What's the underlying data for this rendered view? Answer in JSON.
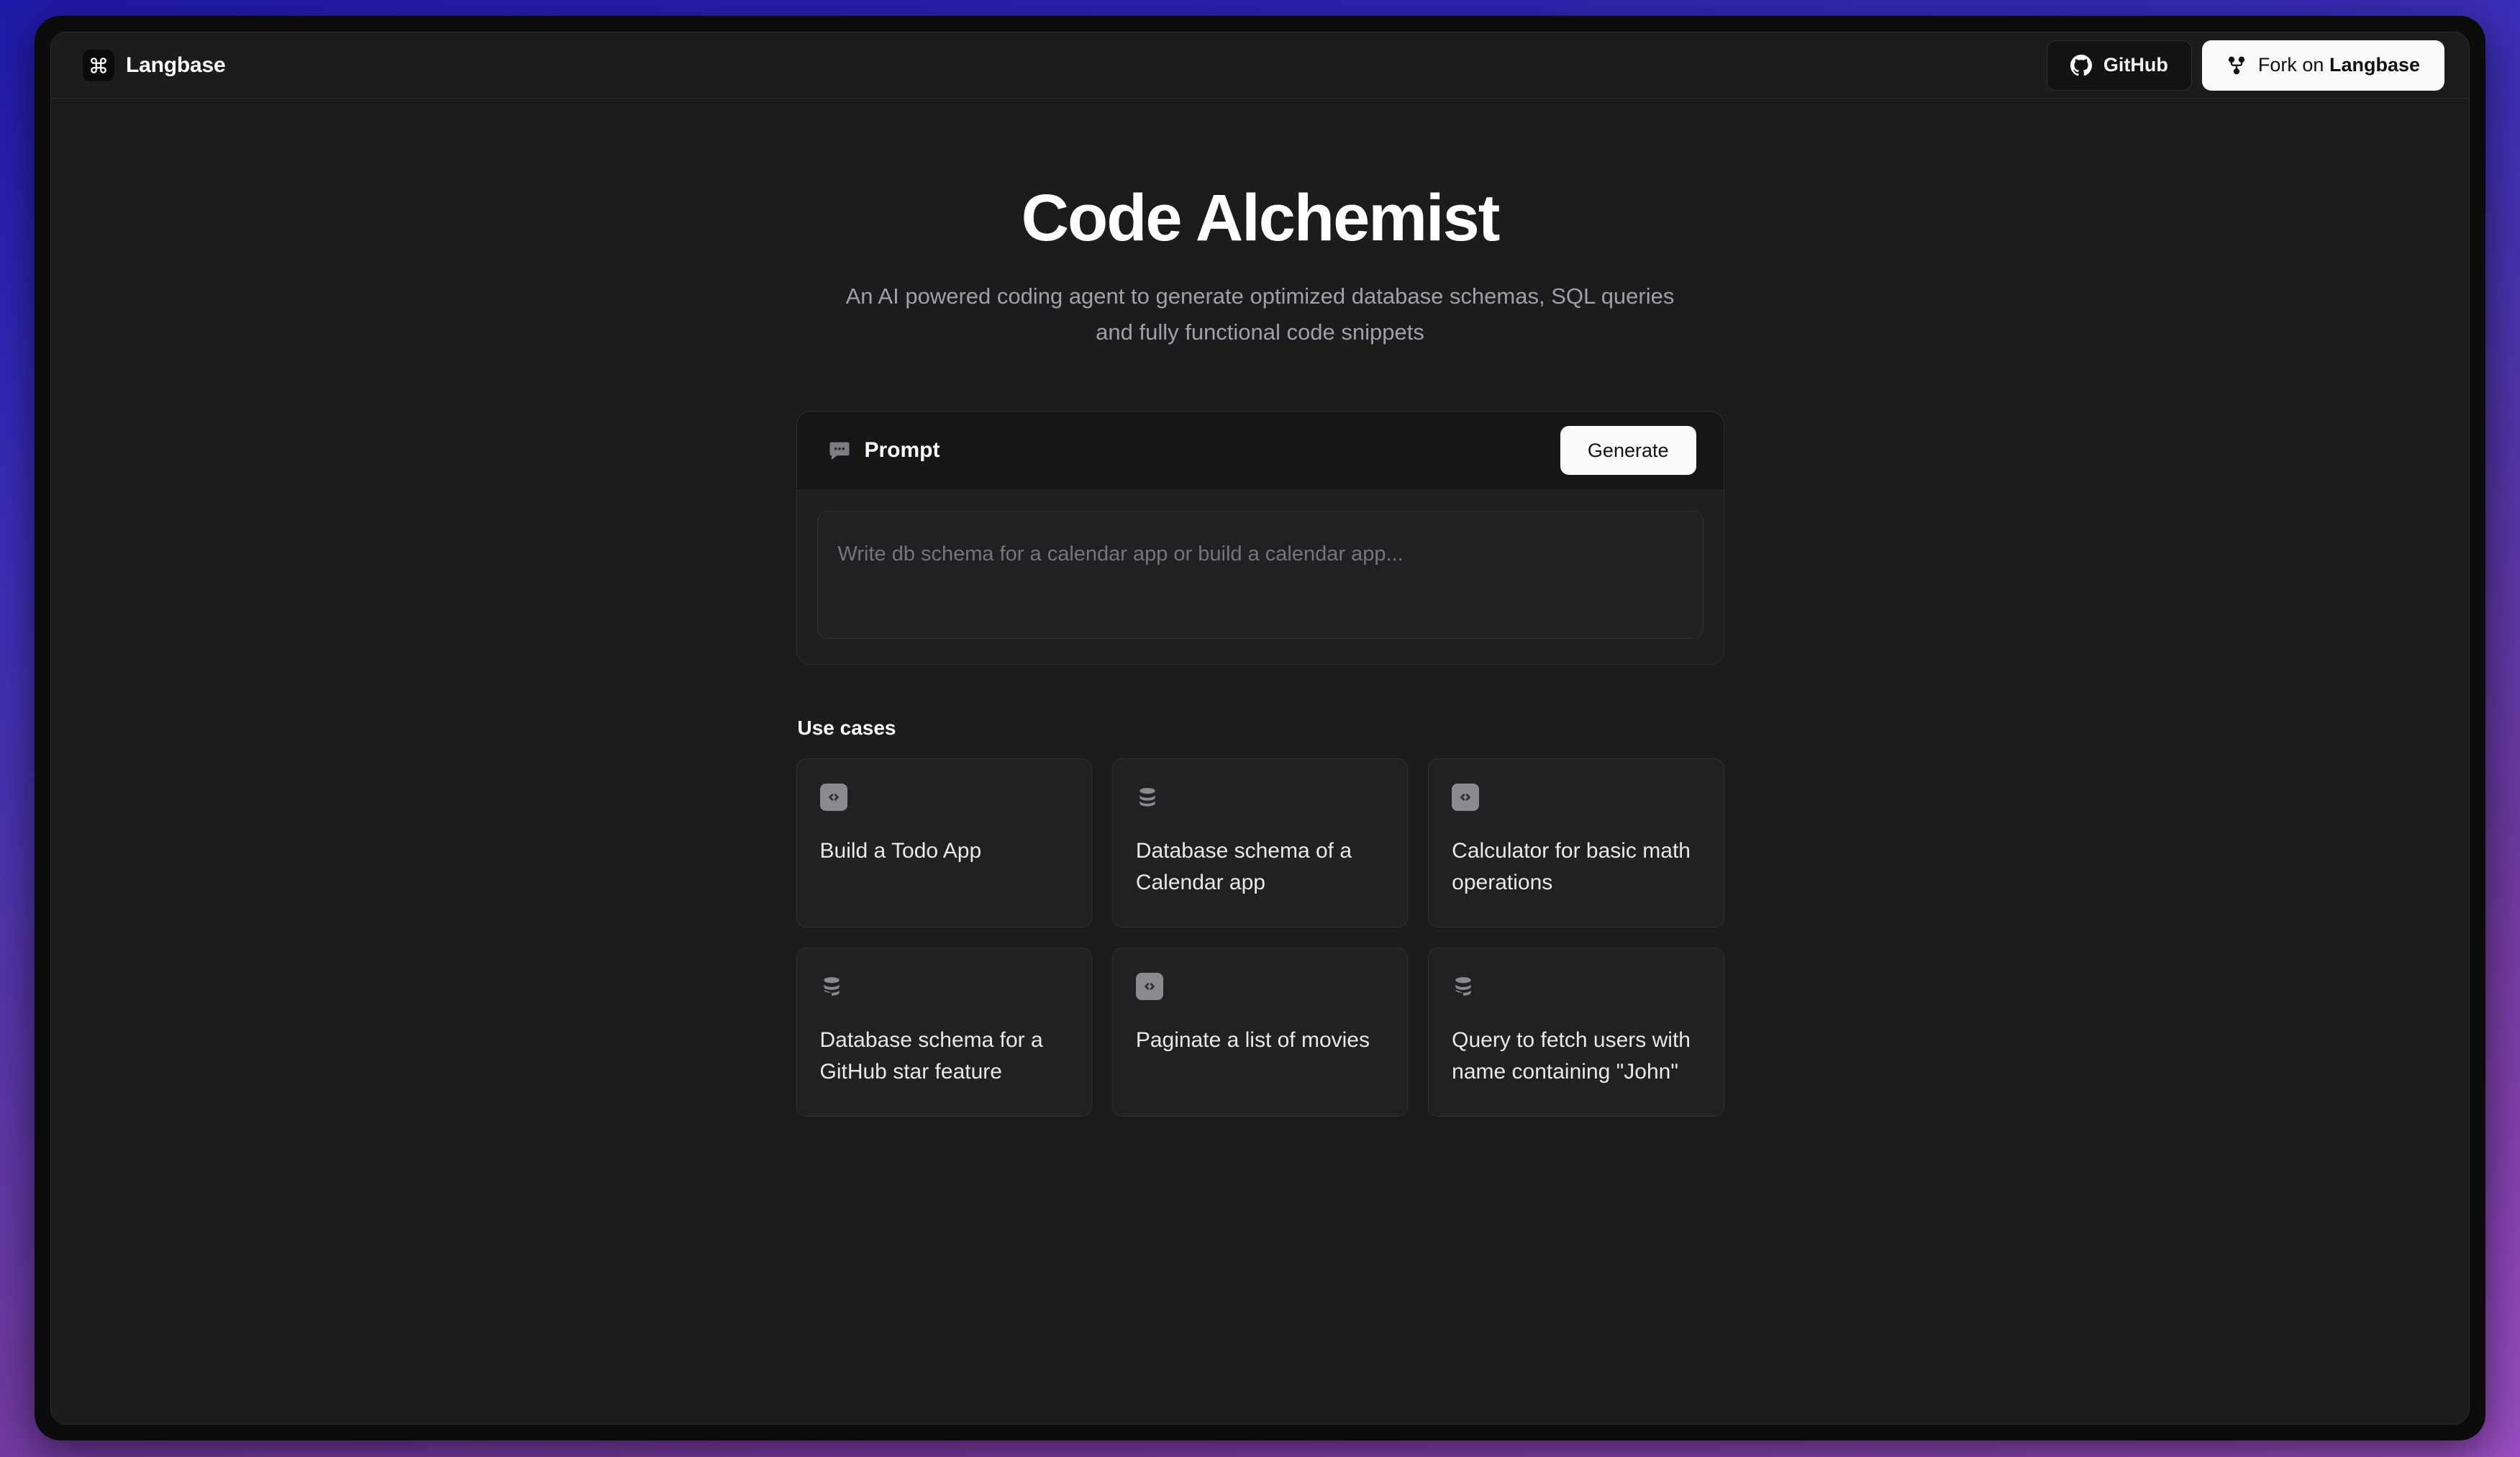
{
  "header": {
    "brand_name": "Langbase",
    "logo_icon": "command-icon",
    "github_button": {
      "label": "GitHub",
      "icon": "github-icon"
    },
    "fork_button": {
      "label_prefix": "Fork on ",
      "label_brand": "Langbase",
      "icon": "git-fork-icon"
    }
  },
  "hero": {
    "title": "Code Alchemist",
    "subtitle": "An AI powered coding agent to generate optimized database schemas, SQL queries and fully functional code snippets"
  },
  "prompt": {
    "label": "Prompt",
    "icon": "message-dots-icon",
    "generate_label": "Generate",
    "value": "",
    "placeholder": "Write db schema for a calendar app or build a calendar app..."
  },
  "use_cases": {
    "title": "Use cases",
    "items": [
      {
        "text": "Build a Todo App",
        "icon": "code-icon"
      },
      {
        "text": "Database schema of a Calendar app",
        "icon": "database-icon"
      },
      {
        "text": "Calculator for basic math operations",
        "icon": "code-icon"
      },
      {
        "text": "Database schema for a GitHub star feature",
        "icon": "database-icon"
      },
      {
        "text": "Paginate a list of movies",
        "icon": "code-icon"
      },
      {
        "text": "Query to fetch users with name containing \"John\"",
        "icon": "database-icon"
      }
    ]
  },
  "colors": {
    "page_gradient_start": "#1f1aa8",
    "page_gradient_end": "#9a4ec2",
    "window_bg": "#1b1c1e",
    "card_bg": "#202123",
    "card_border": "#303135",
    "accent_button": "#fafafa",
    "text_primary": "#ffffff",
    "text_muted": "#a0a1a5",
    "placeholder": "#75767b"
  }
}
